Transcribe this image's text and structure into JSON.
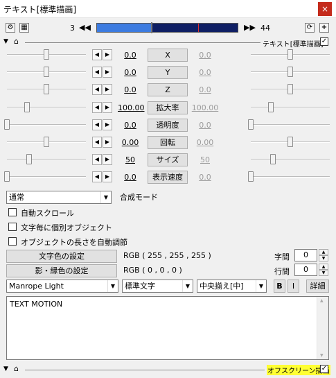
{
  "window": {
    "title": "テキスト[標準描画]",
    "close_label": "×"
  },
  "toolbar": {
    "current_frame": "3",
    "end_frame": "44",
    "position_fraction": 0.72,
    "fill_fraction": 0.39
  },
  "filter_header": {
    "label": "テキスト[標準描画]",
    "enabled": true
  },
  "properties": [
    {
      "name": "X",
      "value": "0.0",
      "end_value": "0.0",
      "left_pos": 0.5,
      "right_pos": 0.5
    },
    {
      "name": "Y",
      "value": "0.0",
      "end_value": "0.0",
      "left_pos": 0.5,
      "right_pos": 0.5
    },
    {
      "name": "Z",
      "value": "0.0",
      "end_value": "0.0",
      "left_pos": 0.5,
      "right_pos": 0.5
    },
    {
      "name": "拡大率",
      "value": "100.00",
      "end_value": "100.00",
      "left_pos": 0.25,
      "right_pos": 0.25
    },
    {
      "name": "透明度",
      "value": "0.0",
      "end_value": "0.0",
      "left_pos": 0.0,
      "right_pos": 0.0
    },
    {
      "name": "回転",
      "value": "0.00",
      "end_value": "0.00",
      "left_pos": 0.5,
      "right_pos": 0.5
    },
    {
      "name": "サイズ",
      "value": "50",
      "end_value": "50",
      "left_pos": 0.28,
      "right_pos": 0.28
    },
    {
      "name": "表示速度",
      "value": "0.0",
      "end_value": "0.0",
      "left_pos": 0.0,
      "right_pos": 0.0
    }
  ],
  "blend": {
    "mode": "通常",
    "label": "合成モード"
  },
  "options": [
    {
      "label": "自動スクロール",
      "checked": false
    },
    {
      "label": "文字毎に個別オブジェクト",
      "checked": false
    },
    {
      "label": "オブジェクトの長さを自動調節",
      "checked": false
    }
  ],
  "colors": {
    "text_button": "文字色の設定",
    "text_rgb": "RGB ( 255 , 255 , 255 )",
    "shadow_button": "影・縁色の設定",
    "shadow_rgb": "RGB ( 0 , 0 , 0 )"
  },
  "spacing": {
    "char_label": "字間",
    "char_value": "0",
    "line_label": "行間",
    "line_value": "0"
  },
  "font": {
    "family": "Manrope Light",
    "style": "標準文字",
    "align": "中央揃え[中]",
    "bold_label": "B",
    "italic_label": "I",
    "detail_label": "詳細"
  },
  "text_content": "TEXT MOTION",
  "footer": {
    "offscreen_label": "オフスクリーン描画",
    "offscreen_enabled": true,
    "highlight_color": "#ffff33"
  },
  "accent_colors": {
    "seek_track": "#0f1f64",
    "seek_fill": "#3c7be0",
    "close": "#c42b1c"
  },
  "icons": {
    "close": "×",
    "prev": "◀◀",
    "next": "▶▶",
    "left": "◀",
    "right": "▶",
    "dropdown": "▼",
    "check": "✓",
    "triangle": "▼",
    "up": "▲",
    "down": "▼"
  }
}
